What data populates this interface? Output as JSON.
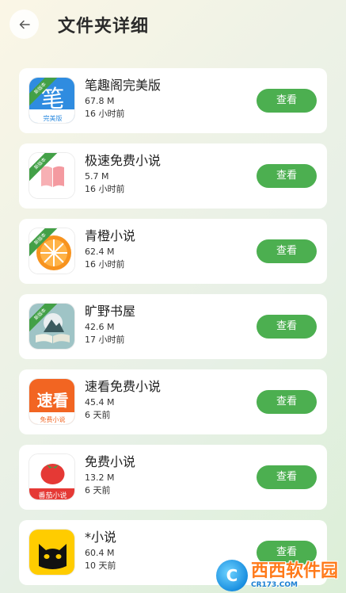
{
  "header": {
    "title": "文件夹详细",
    "back_icon": "arrow-left-icon"
  },
  "colors": {
    "accent": "#4caf50",
    "ribbon": "#43a047"
  },
  "apps": [
    {
      "name": "笔趣阁完美版",
      "size": "67.8 M",
      "time": "16 小时前",
      "button": "查看",
      "ribbon": "新版本",
      "icon": "biquge-icon",
      "icon_text": "笔",
      "icon_sub": "完美版"
    },
    {
      "name": "极速免费小说",
      "size": "5.7 M",
      "time": "16 小时前",
      "button": "查看",
      "ribbon": "新版本",
      "icon": "open-book-icon"
    },
    {
      "name": "青橙小说",
      "size": "62.4 M",
      "time": "16 小时前",
      "button": "查看",
      "ribbon": "新版本",
      "icon": "orange-slice-icon"
    },
    {
      "name": "旷野书屋",
      "size": "42.6 M",
      "time": "17 小时前",
      "button": "查看",
      "ribbon": "新版本",
      "icon": "mountain-book-icon"
    },
    {
      "name": "速看免费小说",
      "size": "45.4 M",
      "time": "6 天前",
      "button": "查看",
      "icon": "sukan-icon",
      "icon_text": "速看",
      "icon_sub": "免费小说"
    },
    {
      "name": "免费小说",
      "size": "13.2 M",
      "time": "6 天前",
      "button": "查看",
      "icon": "tomato-icon",
      "icon_sub": "番茄小说"
    },
    {
      "name": "*小说",
      "size": "60.4 M",
      "time": "10 天前",
      "button": "查看",
      "icon": "black-cat-icon"
    }
  ],
  "watermark": {
    "logo": "C",
    "main": "西西软件园",
    "sub": "CR173.COM"
  }
}
